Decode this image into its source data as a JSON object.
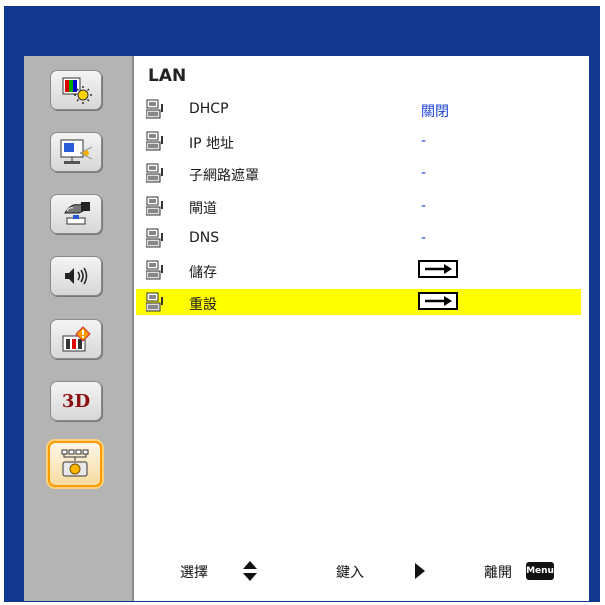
{
  "sidebar": {
    "items": [
      {
        "icon": "image-brightness-icon"
      },
      {
        "icon": "display-screen-icon"
      },
      {
        "icon": "setup-hand-icon"
      },
      {
        "icon": "volume-speaker-icon"
      },
      {
        "icon": "options-info-icon"
      },
      {
        "icon": "3d-icon",
        "label": "3D"
      },
      {
        "icon": "lan-network-icon"
      }
    ],
    "active_index": 6
  },
  "page": {
    "title": "LAN"
  },
  "rows": [
    {
      "label": "DHCP",
      "value": "關閉"
    },
    {
      "label": "IP 地址",
      "value": "-"
    },
    {
      "label": "子網路遮罩",
      "value": "-"
    },
    {
      "label": "閘道",
      "value": "-"
    },
    {
      "label": "DNS",
      "value": "-"
    },
    {
      "label": "儲存",
      "value": "→"
    },
    {
      "label": "重設",
      "value": "→"
    }
  ],
  "selected_row": 6,
  "footer": {
    "select_label": "選擇",
    "enter_label": "鍵入",
    "exit_label": "離開",
    "menu_key": "Menu"
  },
  "colors": {
    "frame": "#12378f",
    "sidebar": "#b4b4b4",
    "highlight": "#ffff00",
    "value_text": "#1a3fd0",
    "active_border": "#ff9a00"
  }
}
